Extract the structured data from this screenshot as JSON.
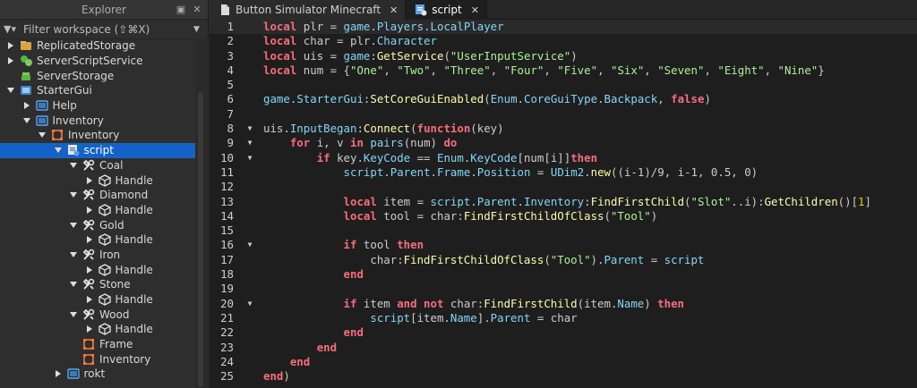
{
  "explorer": {
    "title": "Explorer",
    "filter_placeholder": "Filter workspace (⇧⌘X)",
    "items": [
      {
        "label": "ReplicatedStorage",
        "icon": "replicated-storage-icon"
      },
      {
        "label": "ServerScriptService",
        "icon": "server-script-service-icon"
      },
      {
        "label": "ServerStorage",
        "icon": "server-storage-icon"
      },
      {
        "label": "StarterGui",
        "icon": "starter-gui-icon"
      },
      {
        "label": "Help",
        "icon": "screen-gui-icon"
      },
      {
        "label": "Inventory",
        "icon": "screen-gui-icon"
      },
      {
        "label": "Inventory",
        "icon": "frame-icon"
      },
      {
        "label": "script",
        "icon": "local-script-icon"
      },
      {
        "label": "Coal",
        "icon": "tool-icon"
      },
      {
        "label": "Handle",
        "icon": "part-icon"
      },
      {
        "label": "Diamond",
        "icon": "tool-icon"
      },
      {
        "label": "Handle",
        "icon": "part-icon"
      },
      {
        "label": "Gold",
        "icon": "tool-icon"
      },
      {
        "label": "Handle",
        "icon": "part-icon"
      },
      {
        "label": "Iron",
        "icon": "tool-icon"
      },
      {
        "label": "Handle",
        "icon": "part-icon"
      },
      {
        "label": "Stone",
        "icon": "tool-icon"
      },
      {
        "label": "Handle",
        "icon": "part-icon"
      },
      {
        "label": "Wood",
        "icon": "tool-icon"
      },
      {
        "label": "Handle",
        "icon": "part-icon"
      },
      {
        "label": "Frame",
        "icon": "frame-icon"
      },
      {
        "label": "Inventory",
        "icon": "frame-icon"
      },
      {
        "label": "rokt",
        "icon": "screen-gui-icon"
      }
    ]
  },
  "tabs": [
    {
      "label": "Button Simulator Minecraft",
      "icon": "place-file-icon"
    },
    {
      "label": "script",
      "icon": "local-script-icon"
    }
  ],
  "editor": {
    "line_numbers": [
      "1",
      "2",
      "3",
      "4",
      "5",
      "6",
      "7",
      "8",
      "9",
      "10",
      "11",
      "12",
      "13",
      "14",
      "15",
      "16",
      "17",
      "18",
      "19",
      "20",
      "21",
      "22",
      "23",
      "24",
      "25"
    ]
  },
  "colors": {
    "keyword": "#f86d7c",
    "builtin": "#84d6f7",
    "method": "#fdfbac",
    "string": "#adf195",
    "selection": "#1462c7"
  }
}
